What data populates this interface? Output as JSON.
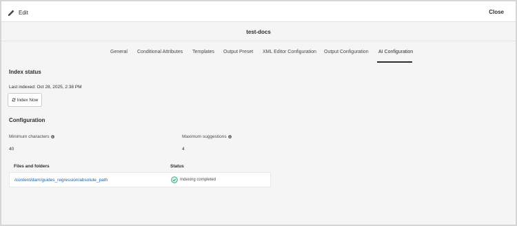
{
  "topbar": {
    "edit_label": "Edit",
    "close_label": "Close"
  },
  "document": {
    "title": "test-docs"
  },
  "tabs": [
    {
      "label": "General"
    },
    {
      "label": "Conditional Attributes"
    },
    {
      "label": "Templates"
    },
    {
      "label": "Output Preset"
    },
    {
      "label": "XML Editor Configuration"
    },
    {
      "label": "Output Configuration"
    },
    {
      "label": "AI Configuration",
      "active": true
    }
  ],
  "index_status": {
    "title": "Index status",
    "last_indexed": "Last indexed: Oct 28, 2025, 2:38 PM",
    "index_now_label": "Index Now"
  },
  "configuration": {
    "title": "Configuration",
    "min_chars_label": "Minimum characters",
    "min_chars_value": "40",
    "max_suggestions_label": "Maximum suggestions",
    "max_suggestions_value": "4"
  },
  "table": {
    "headers": {
      "files": "Files and folders",
      "status": "Status"
    },
    "rows": [
      {
        "path": "/content/dam/guides_regression/absolute_path",
        "status": "Indexing completed"
      }
    ]
  },
  "colors": {
    "link": "#1a5fa8",
    "success": "#2d9d78",
    "background": "#f5f5f5"
  }
}
